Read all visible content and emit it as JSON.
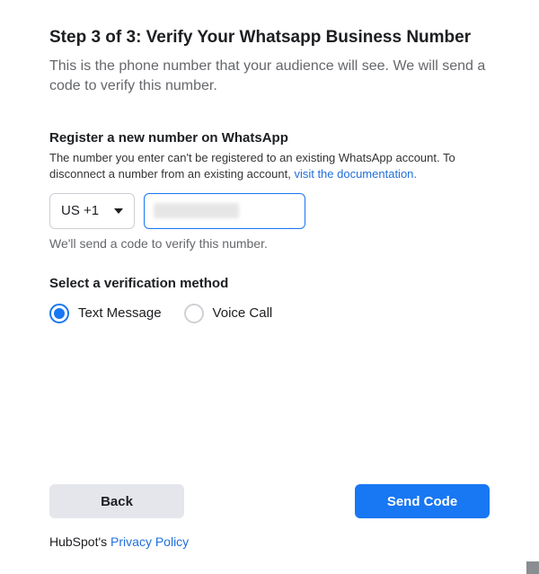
{
  "header": {
    "title": "Step 3 of 3: Verify Your Whatsapp Business Number",
    "subtitle": "This is the phone number that your audience will see. We will send a code to verify this number."
  },
  "register": {
    "label": "Register a new number on WhatsApp",
    "desc_part1": "The number you enter can't be registered to an existing WhatsApp account. To disconnect a number from an existing account, ",
    "doc_link_text": "visit the documentation.",
    "country_code": "US +1",
    "helper": "We'll send a code to verify this number."
  },
  "verification": {
    "label": "Select a verification method",
    "options": [
      {
        "label": "Text Message",
        "selected": true
      },
      {
        "label": "Voice Call",
        "selected": false
      }
    ]
  },
  "footer": {
    "back_label": "Back",
    "send_label": "Send Code",
    "privacy_prefix": "HubSpot's ",
    "privacy_link": "Privacy Policy"
  }
}
